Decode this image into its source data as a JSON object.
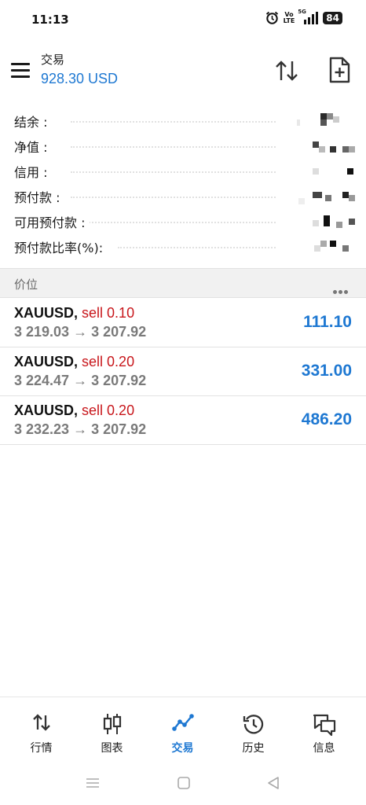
{
  "status_bar": {
    "time": "11:13",
    "volte_top": "Vo",
    "volte_bottom": "LTE",
    "network": "5G",
    "battery": "84"
  },
  "header": {
    "title": "交易",
    "balance": "928.30 USD"
  },
  "summary": {
    "rows": [
      {
        "label": "结余 :"
      },
      {
        "label": "净值 :"
      },
      {
        "label": "信用 :"
      },
      {
        "label": "预付款 :"
      },
      {
        "label": "可用预付款 :"
      },
      {
        "label": "预付款比率(%):"
      }
    ]
  },
  "positions": {
    "section_title": "价位",
    "items": [
      {
        "symbol": "XAUUSD,",
        "action": "sell 0.10",
        "prices": "3 219.03 → 3 207.92",
        "profit": "111.10"
      },
      {
        "symbol": "XAUUSD,",
        "action": "sell 0.20",
        "prices": "3 224.47 → 3 207.92",
        "profit": "331.00"
      },
      {
        "symbol": "XAUUSD,",
        "action": "sell 0.20",
        "prices": "3 232.23 → 3 207.92",
        "profit": "486.20"
      }
    ]
  },
  "bottom_nav": {
    "items": [
      {
        "label": "行情",
        "icon": "quotes-arrows-icon"
      },
      {
        "label": "图表",
        "icon": "candlestick-chart-icon"
      },
      {
        "label": "交易",
        "icon": "trade-line-icon",
        "active": true
      },
      {
        "label": "历史",
        "icon": "history-clock-icon"
      },
      {
        "label": "信息",
        "icon": "messages-icon"
      }
    ]
  },
  "colors": {
    "accent": "#1e78d2",
    "sell": "#c8171c",
    "muted": "#7a7a7a"
  }
}
